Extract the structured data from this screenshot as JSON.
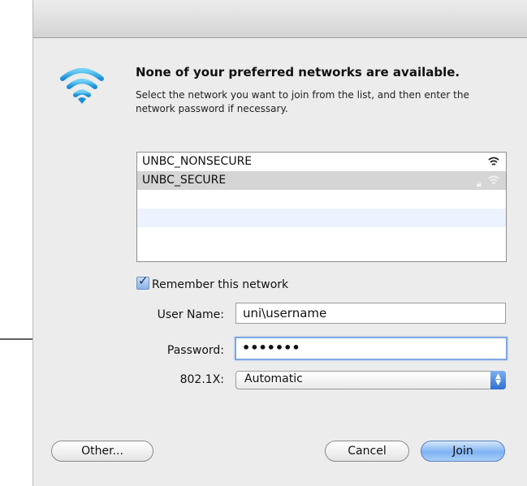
{
  "dialog": {
    "heading": "None of your preferred networks are available.",
    "subtext": "Select the network you want to join from the list, and then enter the network password if necessary.",
    "networks": [
      {
        "name": "UNBC_NONSECURE",
        "secured": false,
        "selected": false
      },
      {
        "name": "UNBC_SECURE",
        "secured": true,
        "selected": true
      },
      {
        "name": "",
        "secured": false,
        "selected": false
      },
      {
        "name": "",
        "secured": false,
        "selected": false
      },
      {
        "name": "",
        "secured": false,
        "selected": false
      }
    ],
    "remember_label": "Remember this network",
    "remember_checked": true,
    "username_label": "User Name:",
    "username_value": "uni\\username",
    "password_label": "Password:",
    "password_value": "•••••••",
    "x8021_label": "802.1X:",
    "x8021_value": "Automatic",
    "other_button": "Other...",
    "cancel_button": "Cancel",
    "join_button": "Join"
  },
  "icons": [
    "wifi-icon",
    "lock-icon",
    "checkbox-check-icon",
    "popup-arrows-icon"
  ],
  "colors": {
    "accent": "#2f6fd2",
    "selection": "#d5d5d5",
    "alt_row": "#edf3fe"
  }
}
